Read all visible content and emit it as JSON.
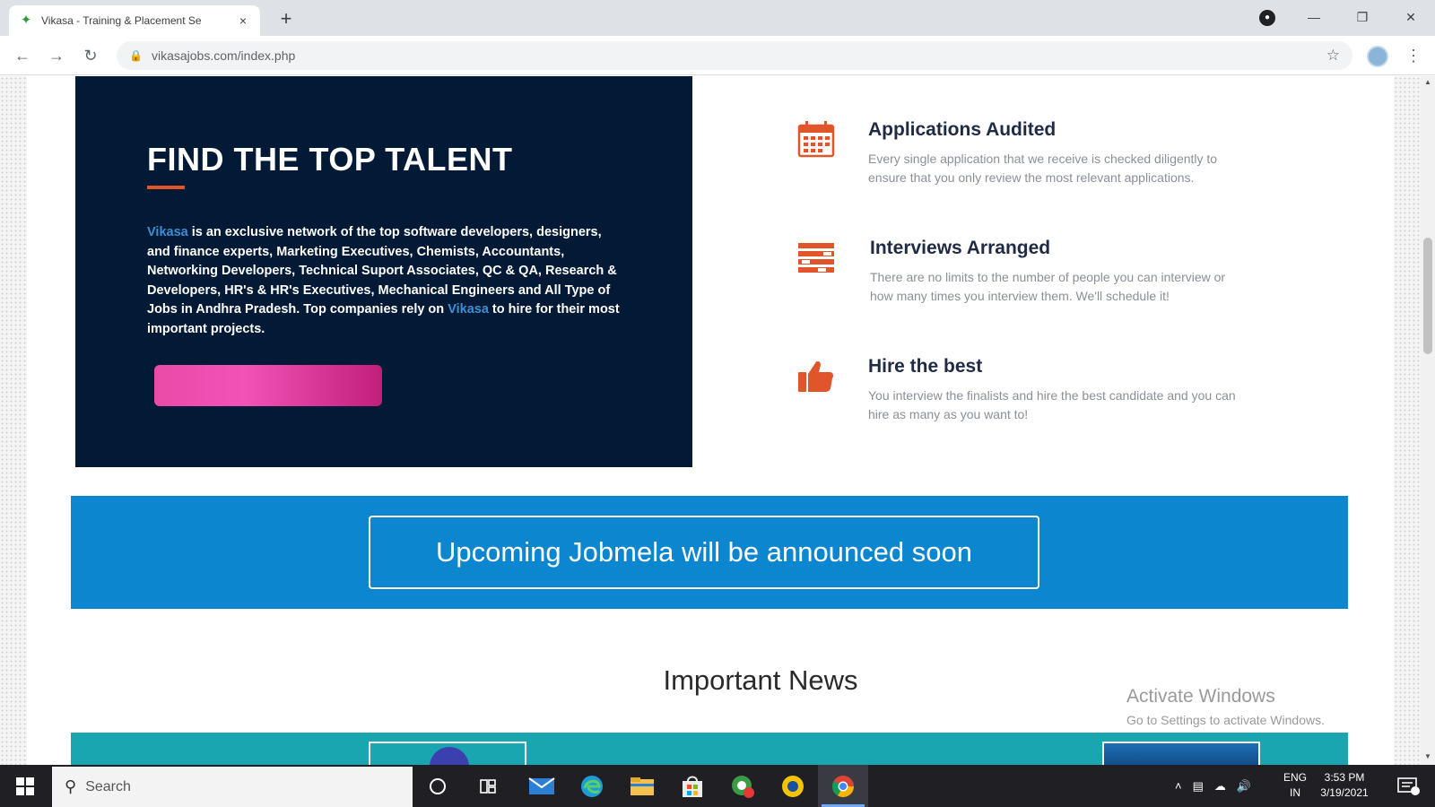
{
  "browser": {
    "tab_title": "Vikasa - Training & Placement Se",
    "tab_close": "×",
    "new_tab": "+",
    "url": "vikasajobs.com/index.php"
  },
  "talent": {
    "title": "FIND THE TOP TALENT",
    "brand": "Vikasa",
    "body_part1": " is an exclusive network of the top software developers, designers, and finance experts, Marketing Executives, Chemists, Accountants, Networking Developers, Technical Suport Associates, QC & QA, Research & Developers, HR's & HR's Executives, Mechanical Engineers and All Type of Jobs in Andhra Pradesh. Top companies rely on ",
    "body_part2": " to hire for their most important projects."
  },
  "features": [
    {
      "title": "Applications Audited",
      "desc": "Every single application that we receive is checked diligently to ensure that you only review the most relevant applications."
    },
    {
      "title": "Interviews Arranged",
      "desc": "There are no limits to the number of people you can interview or how many times you interview them. We'll schedule it!"
    },
    {
      "title": "Hire the best",
      "desc": "You interview the finalists and hire the best candidate and you can hire as many as you want to!"
    }
  ],
  "banner": {
    "text": "Upcoming Jobmela will be announced soon"
  },
  "news": {
    "title": "Important News"
  },
  "watermark": {
    "line1": "Activate Windows",
    "line2": "Go to Settings to activate Windows."
  },
  "taskbar": {
    "search_placeholder": "Search",
    "lang_line1": "ENG",
    "lang_line2": "IN",
    "time": "3:53 PM",
    "date": "3/19/2021"
  },
  "colors": {
    "card_bg": "#031a36",
    "accent_orange": "#e0552a",
    "brand_blue": "#3a8fd6",
    "banner_blue": "#0b86cf",
    "news_teal": "#1aa6b1",
    "cta_pink": "#ea4ba9"
  }
}
